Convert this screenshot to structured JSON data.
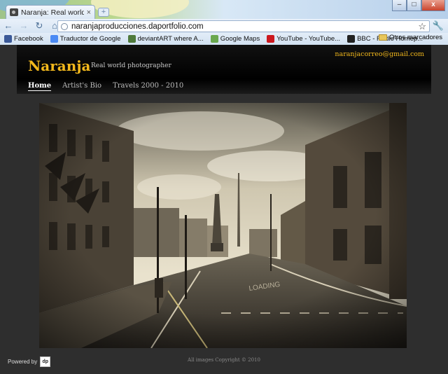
{
  "browser": {
    "tab_title": "Naranja: Real world phot...",
    "tab_close": "×",
    "new_tab": "+",
    "url": "naranjaproducciones.daportfolio.com",
    "window_buttons": {
      "minimize": "–",
      "maximize": "□",
      "close": "x"
    },
    "icons": {
      "back": "back-icon",
      "forward": "forward-icon",
      "reload": "reload-icon",
      "home": "home-icon",
      "star": "star-icon",
      "wrench": "wrench-icon"
    }
  },
  "bookmarks": {
    "items": [
      {
        "label": "Facebook",
        "color": "#3b5998"
      },
      {
        "label": "Traductor de Google",
        "color": "#4a8af4"
      },
      {
        "label": "deviantART where A...",
        "color": "#4f7a3c"
      },
      {
        "label": "Google Maps",
        "color": "#6aa84f"
      },
      {
        "label": "YouTube - YouTube...",
        "color": "#cc181e"
      },
      {
        "label": "BBC - Radio Homep...",
        "color": "#222222"
      }
    ],
    "other": "Otros marcadores"
  },
  "site": {
    "logo": "Naranja",
    "tagline": "Real world photographer",
    "email": "naranjacorreo@gmail.com",
    "nav": [
      "Home",
      "Artist's Bio",
      "Travels 2000 - 2010"
    ],
    "active_nav": 0,
    "accent": "#f2b81c"
  },
  "footer": {
    "powered_by": "Powered by",
    "copyright": "All images Copyright © 2010"
  }
}
